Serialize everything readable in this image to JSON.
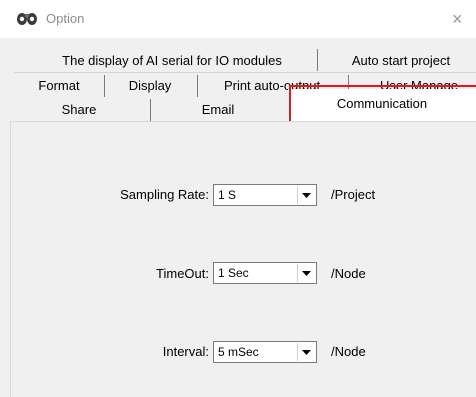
{
  "window": {
    "title": "Option",
    "close_glyph": "×"
  },
  "tabs": {
    "row1": [
      "The display of AI serial for IO modules",
      "Auto start project"
    ],
    "row2": [
      "Format",
      "Display",
      "Print auto-output",
      "User Manage"
    ],
    "row3": [
      "Share",
      "Email",
      "Communication"
    ],
    "selected": "Communication"
  },
  "communication": {
    "sampling": {
      "label": "Sampling Rate:",
      "value": "1 S",
      "unit": "/Project"
    },
    "timeout": {
      "label": "TimeOut:",
      "value": "1 Sec",
      "unit": "/Node"
    },
    "interval": {
      "label": "Interval:",
      "value": "5 mSec",
      "unit": "/Node"
    }
  },
  "colors": {
    "highlight": "#e8151b",
    "active_tab": "#ffffff",
    "panel": "#f0f0f0"
  },
  "icons": {
    "app": "app-logo-icon",
    "combo": "chevron-down-icon"
  }
}
